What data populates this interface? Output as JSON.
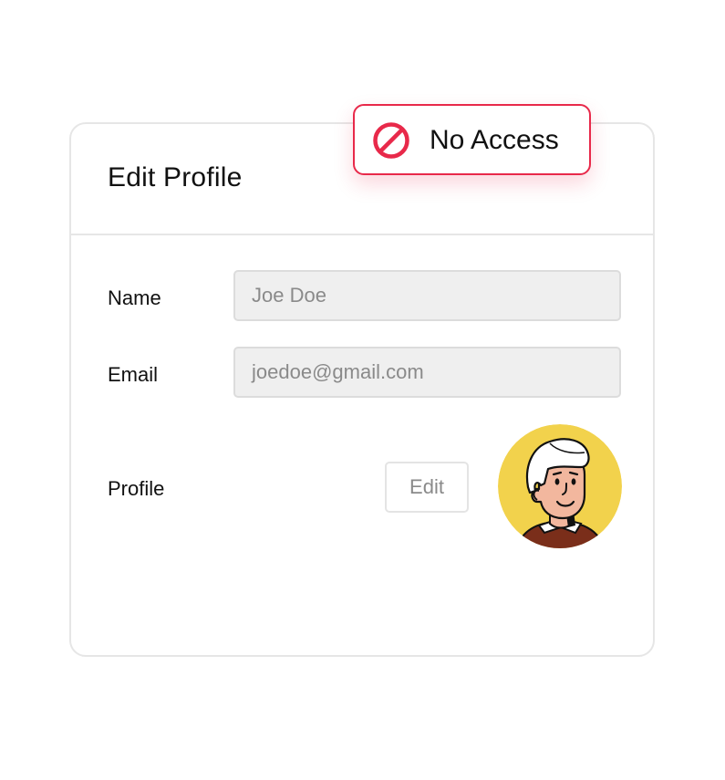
{
  "card": {
    "title": "Edit Profile"
  },
  "form": {
    "name_label": "Name",
    "name_value": "Joe Doe",
    "email_label": "Email",
    "email_value": "joedoe@gmail.com",
    "profile_label": "Profile",
    "edit_label": "Edit"
  },
  "badge": {
    "label": "No Access",
    "icon": "no-entry-icon",
    "color": "#e8294a"
  },
  "avatar": {
    "icon": "user-avatar-illustration",
    "background_color": "#f2d24c"
  }
}
